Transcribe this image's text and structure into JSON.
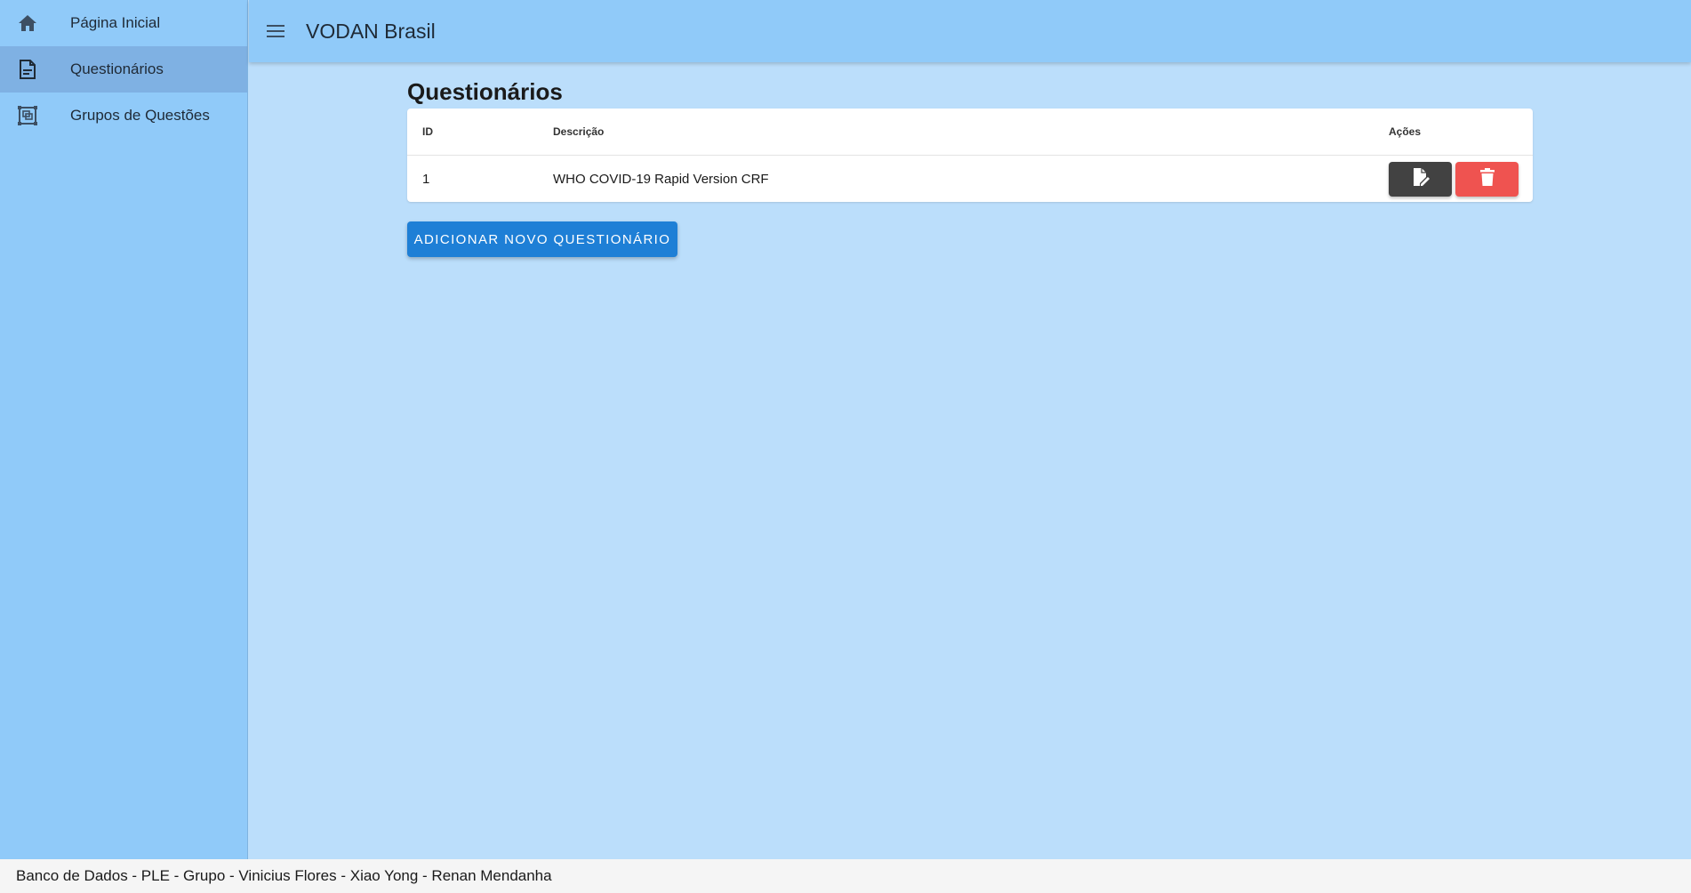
{
  "sidebar": {
    "items": [
      {
        "label": "Página Inicial",
        "icon": "home-icon",
        "active": false
      },
      {
        "label": "Questionários",
        "icon": "document-icon",
        "active": true
      },
      {
        "label": "Grupos de Questões",
        "icon": "group-icon",
        "active": false
      }
    ]
  },
  "appbar": {
    "menu_icon": "hamburger-menu-icon",
    "title": "VODAN Brasil"
  },
  "main": {
    "title": "Questionários",
    "table": {
      "columns": [
        "ID",
        "Descrição",
        "Ações"
      ],
      "rows": [
        {
          "id": "1",
          "description": "WHO COVID-19 Rapid Version CRF"
        }
      ]
    },
    "add_button": "ADICIONAR NOVO QUESTIONÁRIO"
  },
  "footer": {
    "text": "Banco de Dados - PLE - Grupo - Vinicius Flores - Xiao Yong - Renan Mendanha"
  },
  "colors": {
    "sidebar": "#90caf9",
    "background": "#bbdefb",
    "primary_button": "#1e7fd6",
    "edit_button": "#424242",
    "delete_button": "#ef5350"
  }
}
